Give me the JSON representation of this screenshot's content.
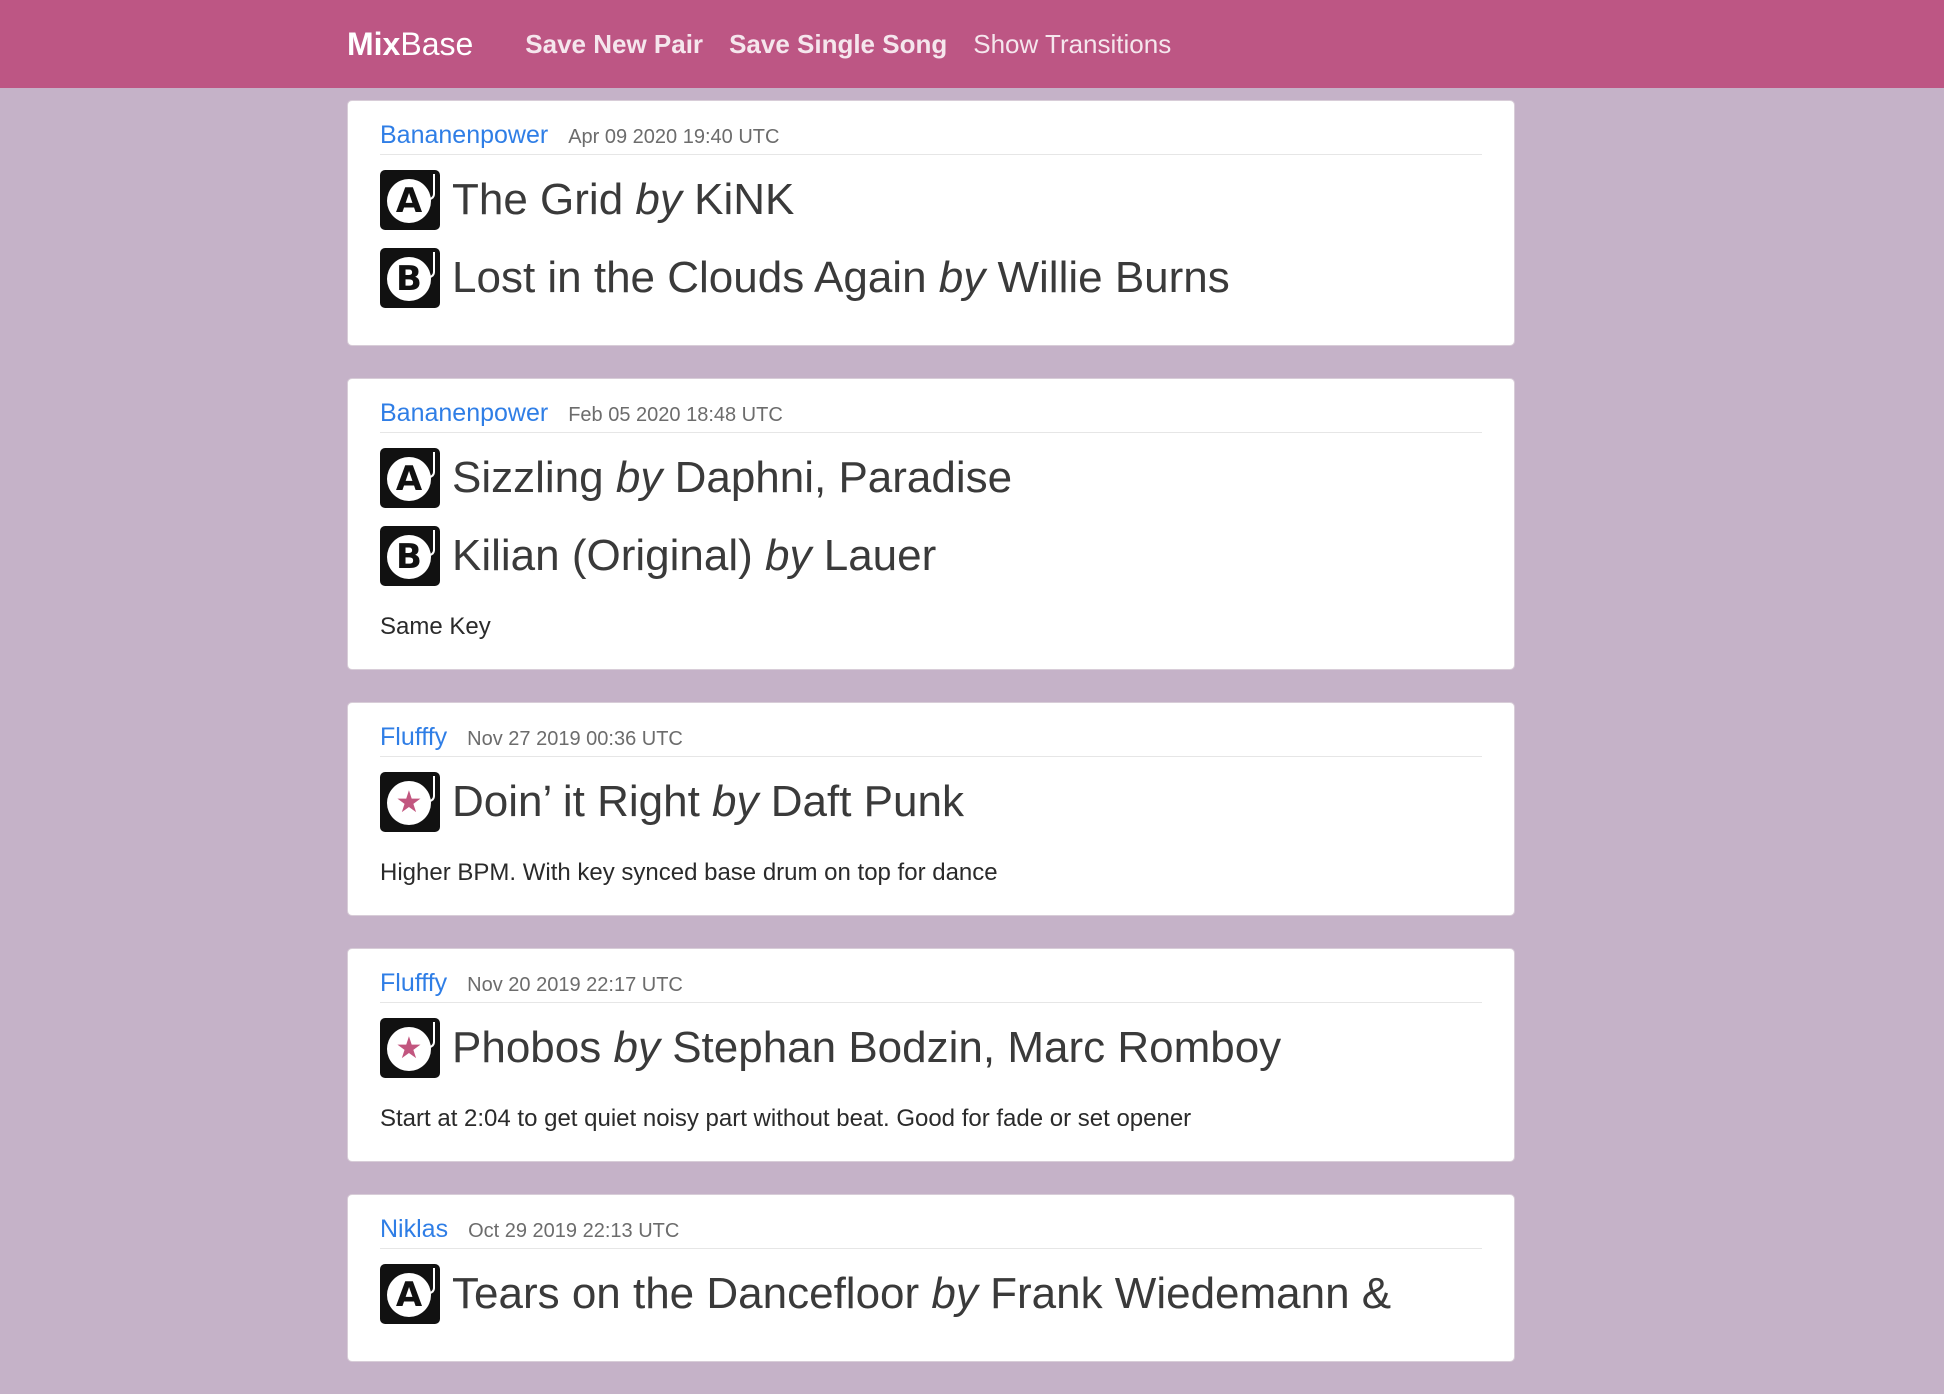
{
  "nav": {
    "brand_bold": "Mix",
    "brand_light": "Base",
    "links": [
      "Save New Pair",
      "Save Single Song",
      "Show Transitions"
    ]
  },
  "by_label": "by",
  "colors": {
    "navbar": "#bd5684",
    "background": "#c5b2c8",
    "link": "#2f7ee6",
    "accent_star": "#c2567f"
  },
  "posts": [
    {
      "user": "Bananenpower",
      "time": "Apr 09 2020 19:40 UTC",
      "songs": [
        {
          "deck": "A",
          "icon": "deck-a-icon",
          "title": "The Grid",
          "artist": "KiNK"
        },
        {
          "deck": "B",
          "icon": "deck-b-icon",
          "title": "Lost in the Clouds Again",
          "artist": "Willie Burns"
        }
      ],
      "note": ""
    },
    {
      "user": "Bananenpower",
      "time": "Feb 05 2020 18:48 UTC",
      "songs": [
        {
          "deck": "A",
          "icon": "deck-a-icon",
          "title": "Sizzling",
          "artist": "Daphni, Paradise"
        },
        {
          "deck": "B",
          "icon": "deck-b-icon",
          "title": "Kilian (Original)",
          "artist": "Lauer"
        }
      ],
      "note": "Same Key"
    },
    {
      "user": "Flufffy",
      "time": "Nov 27 2019 00:36 UTC",
      "songs": [
        {
          "deck": "★",
          "icon": "single-song-star-icon",
          "title": "Doin’ it Right",
          "artist": "Daft Punk"
        }
      ],
      "note": "Higher BPM. With key synced base drum on top for dance"
    },
    {
      "user": "Flufffy",
      "time": "Nov 20 2019 22:17 UTC",
      "songs": [
        {
          "deck": "★",
          "icon": "single-song-star-icon",
          "title": "Phobos",
          "artist": "Stephan Bodzin, Marc Romboy"
        }
      ],
      "note": "Start at 2:04 to get quiet noisy part without beat. Good for fade or set opener"
    },
    {
      "user": "Niklas",
      "time": "Oct 29 2019 22:13 UTC",
      "songs": [
        {
          "deck": "A",
          "icon": "deck-a-icon",
          "title": "Tears on the Dancefloor",
          "artist": "Frank Wiedemann &"
        }
      ],
      "note": ""
    }
  ]
}
